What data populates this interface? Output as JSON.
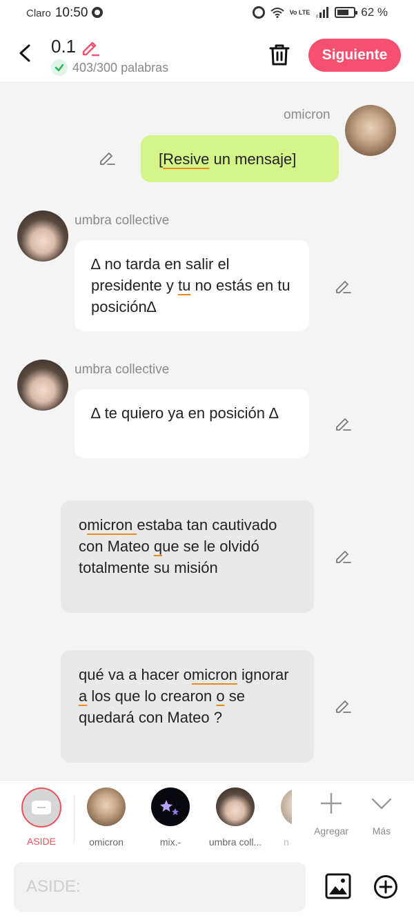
{
  "status_bar": {
    "carrier": "Claro",
    "time": "10:50",
    "network": "Vo LTE",
    "battery": "62 %"
  },
  "header": {
    "title": "0.1",
    "word_count": "403/300 palabras",
    "next_label": "Siguiente",
    "accent": "#f5506f"
  },
  "messages": [
    {
      "sender": "omicron",
      "segments": [
        {
          "t": "["
        },
        {
          "t": "Resive",
          "u": true
        },
        {
          "t": " un mensaje]"
        }
      ]
    },
    {
      "sender": "umbra collective",
      "segments": [
        {
          "t": "∆ no tarda en salir el presidente y "
        },
        {
          "t": "tu",
          "u": true
        },
        {
          "t": " no estás en tu posición∆"
        }
      ]
    },
    {
      "sender": "umbra collective",
      "segments": [
        {
          "t": "∆ te quiero ya en posición ∆"
        }
      ]
    },
    {
      "sender": "",
      "segments": [
        {
          "t": "o"
        },
        {
          "t": "micron  ",
          "u": true
        },
        {
          "t": "estaba tan cautivado con Mateo "
        },
        {
          "t": " q",
          "u": true
        },
        {
          "t": "ue se le olvidó totalmente su misión"
        }
      ]
    },
    {
      "sender": "",
      "segments": [
        {
          "t": "qué va a hacer o"
        },
        {
          "t": "micron",
          "u": true
        },
        {
          "t": " ignorar "
        },
        {
          "t": " a",
          "u": true
        },
        {
          "t": " los que lo crearon "
        },
        {
          "t": " o",
          "u": true
        },
        {
          "t": " se quedará con Mateo ?"
        }
      ]
    }
  ],
  "characters": [
    {
      "label": "ASIDE"
    },
    {
      "label": "omicron"
    },
    {
      "label": "mix.-"
    },
    {
      "label": "umbra coll..."
    },
    {
      "label": "n"
    }
  ],
  "actions": {
    "add_label": "Agregar",
    "more_label": "Más"
  },
  "input": {
    "placeholder": "ASIDE:"
  }
}
